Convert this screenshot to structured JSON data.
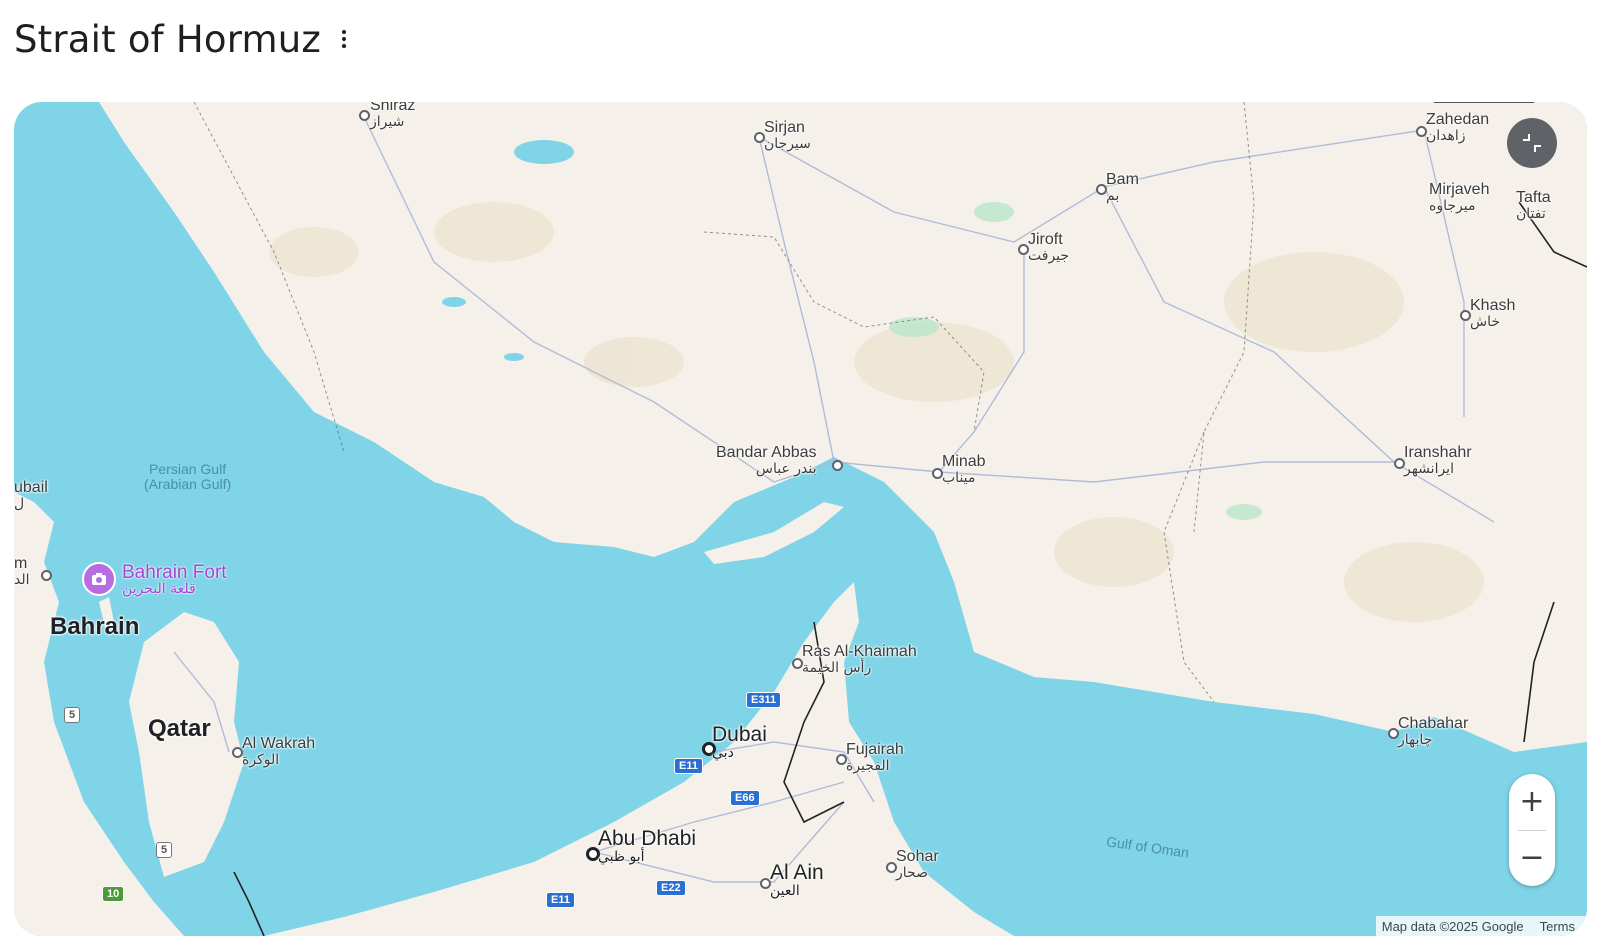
{
  "header": {
    "title": "Strait of Hormuz",
    "menu_icon": "more-vert-icon"
  },
  "map": {
    "colors": {
      "water": "#7fd4e8",
      "land": "#f5f1ea",
      "accent_poi": "#b76ce0"
    },
    "water_labels": {
      "persian_gulf": "Persian Gulf",
      "persian_gulf_alt": "(Arabian Gulf)",
      "gulf_of_oman": "Gulf of Oman"
    },
    "countries": {
      "bahrain": "Bahrain",
      "qatar": "Qatar"
    },
    "cities": {
      "shiraz": {
        "en": "Shiraz",
        "ar": "شیراز"
      },
      "sirjan": {
        "en": "Sirjan",
        "ar": "سیرجان"
      },
      "zahedan": {
        "en": "Zahedan",
        "ar": "زاهدان"
      },
      "bam": {
        "en": "Bam",
        "ar": "بم"
      },
      "jiroft": {
        "en": "Jiroft",
        "ar": "جیرفت"
      },
      "mirjaveh": {
        "en": "Mirjaveh",
        "ar": "میرجاوه"
      },
      "tafta": {
        "en": "Tafta",
        "ar": "تفتان"
      },
      "khash": {
        "en": "Khash",
        "ar": "خاش"
      },
      "bandar_abbas": {
        "en": "Bandar Abbas",
        "ar": "بندر عباس"
      },
      "minab": {
        "en": "Minab",
        "ar": "میناب"
      },
      "iranshahr": {
        "en": "Iranshahr",
        "ar": "ایرانشهر"
      },
      "dubail": {
        "en": "ubail",
        "ar": "ل"
      },
      "dammam": {
        "en": "m",
        "ar": "الد"
      },
      "ras_al_khaimah": {
        "en": "Ras Al-Khaimah",
        "ar": "رأس الخيمة"
      },
      "dubai": {
        "en": "Dubai",
        "ar": "دبي"
      },
      "fujairah": {
        "en": "Fujairah",
        "ar": "الفجيرة"
      },
      "al_wakrah": {
        "en": "Al Wakrah",
        "ar": "الوكرة"
      },
      "abu_dhabi": {
        "en": "Abu Dhabi",
        "ar": "أبو ظبي"
      },
      "al_ain": {
        "en": "Al Ain",
        "ar": "العين"
      },
      "sohar": {
        "en": "Sohar",
        "ar": "صحار"
      },
      "chabahar": {
        "en": "Chabahar",
        "ar": "چابهار"
      }
    },
    "poi": {
      "name": "Bahrain Fort",
      "name_ar": "قلعة البحرين",
      "icon": "camera-icon"
    },
    "road_shields": [
      "E311",
      "E11",
      "E66",
      "E11",
      "E22",
      "5",
      "5",
      "10"
    ],
    "controls": {
      "fullscreen_icon": "exit-fullscreen-icon",
      "zoom_in": "+",
      "zoom_out": "−"
    },
    "attribution": {
      "data": "Map data ©2025 Google",
      "terms": "Terms"
    }
  }
}
